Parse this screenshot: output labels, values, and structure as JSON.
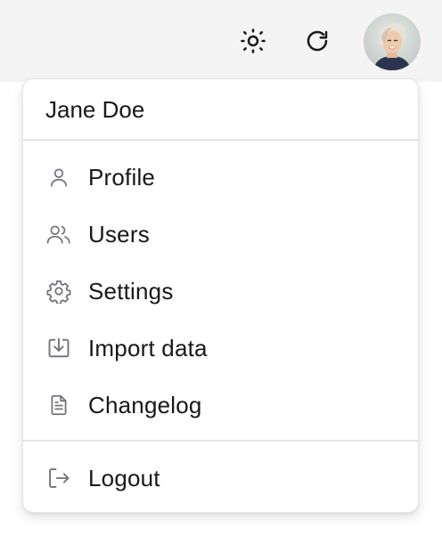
{
  "topbar": {
    "theme_toggle_icon": "sun-icon",
    "refresh_icon": "refresh-icon",
    "avatar_icon": "user-avatar"
  },
  "menu": {
    "user_name": "Jane Doe",
    "items": [
      {
        "label": "Profile",
        "icon": "user-icon"
      },
      {
        "label": "Users",
        "icon": "users-icon"
      },
      {
        "label": "Settings",
        "icon": "gear-icon"
      },
      {
        "label": "Import data",
        "icon": "import-icon"
      },
      {
        "label": "Changelog",
        "icon": "file-text-icon"
      }
    ],
    "logout": {
      "label": "Logout",
      "icon": "logout-icon"
    }
  },
  "colors": {
    "topbar_bg": "#f4f4f5",
    "menu_border": "#e4e4e7",
    "icon_color": "#71717a",
    "text_color": "#18181b"
  }
}
